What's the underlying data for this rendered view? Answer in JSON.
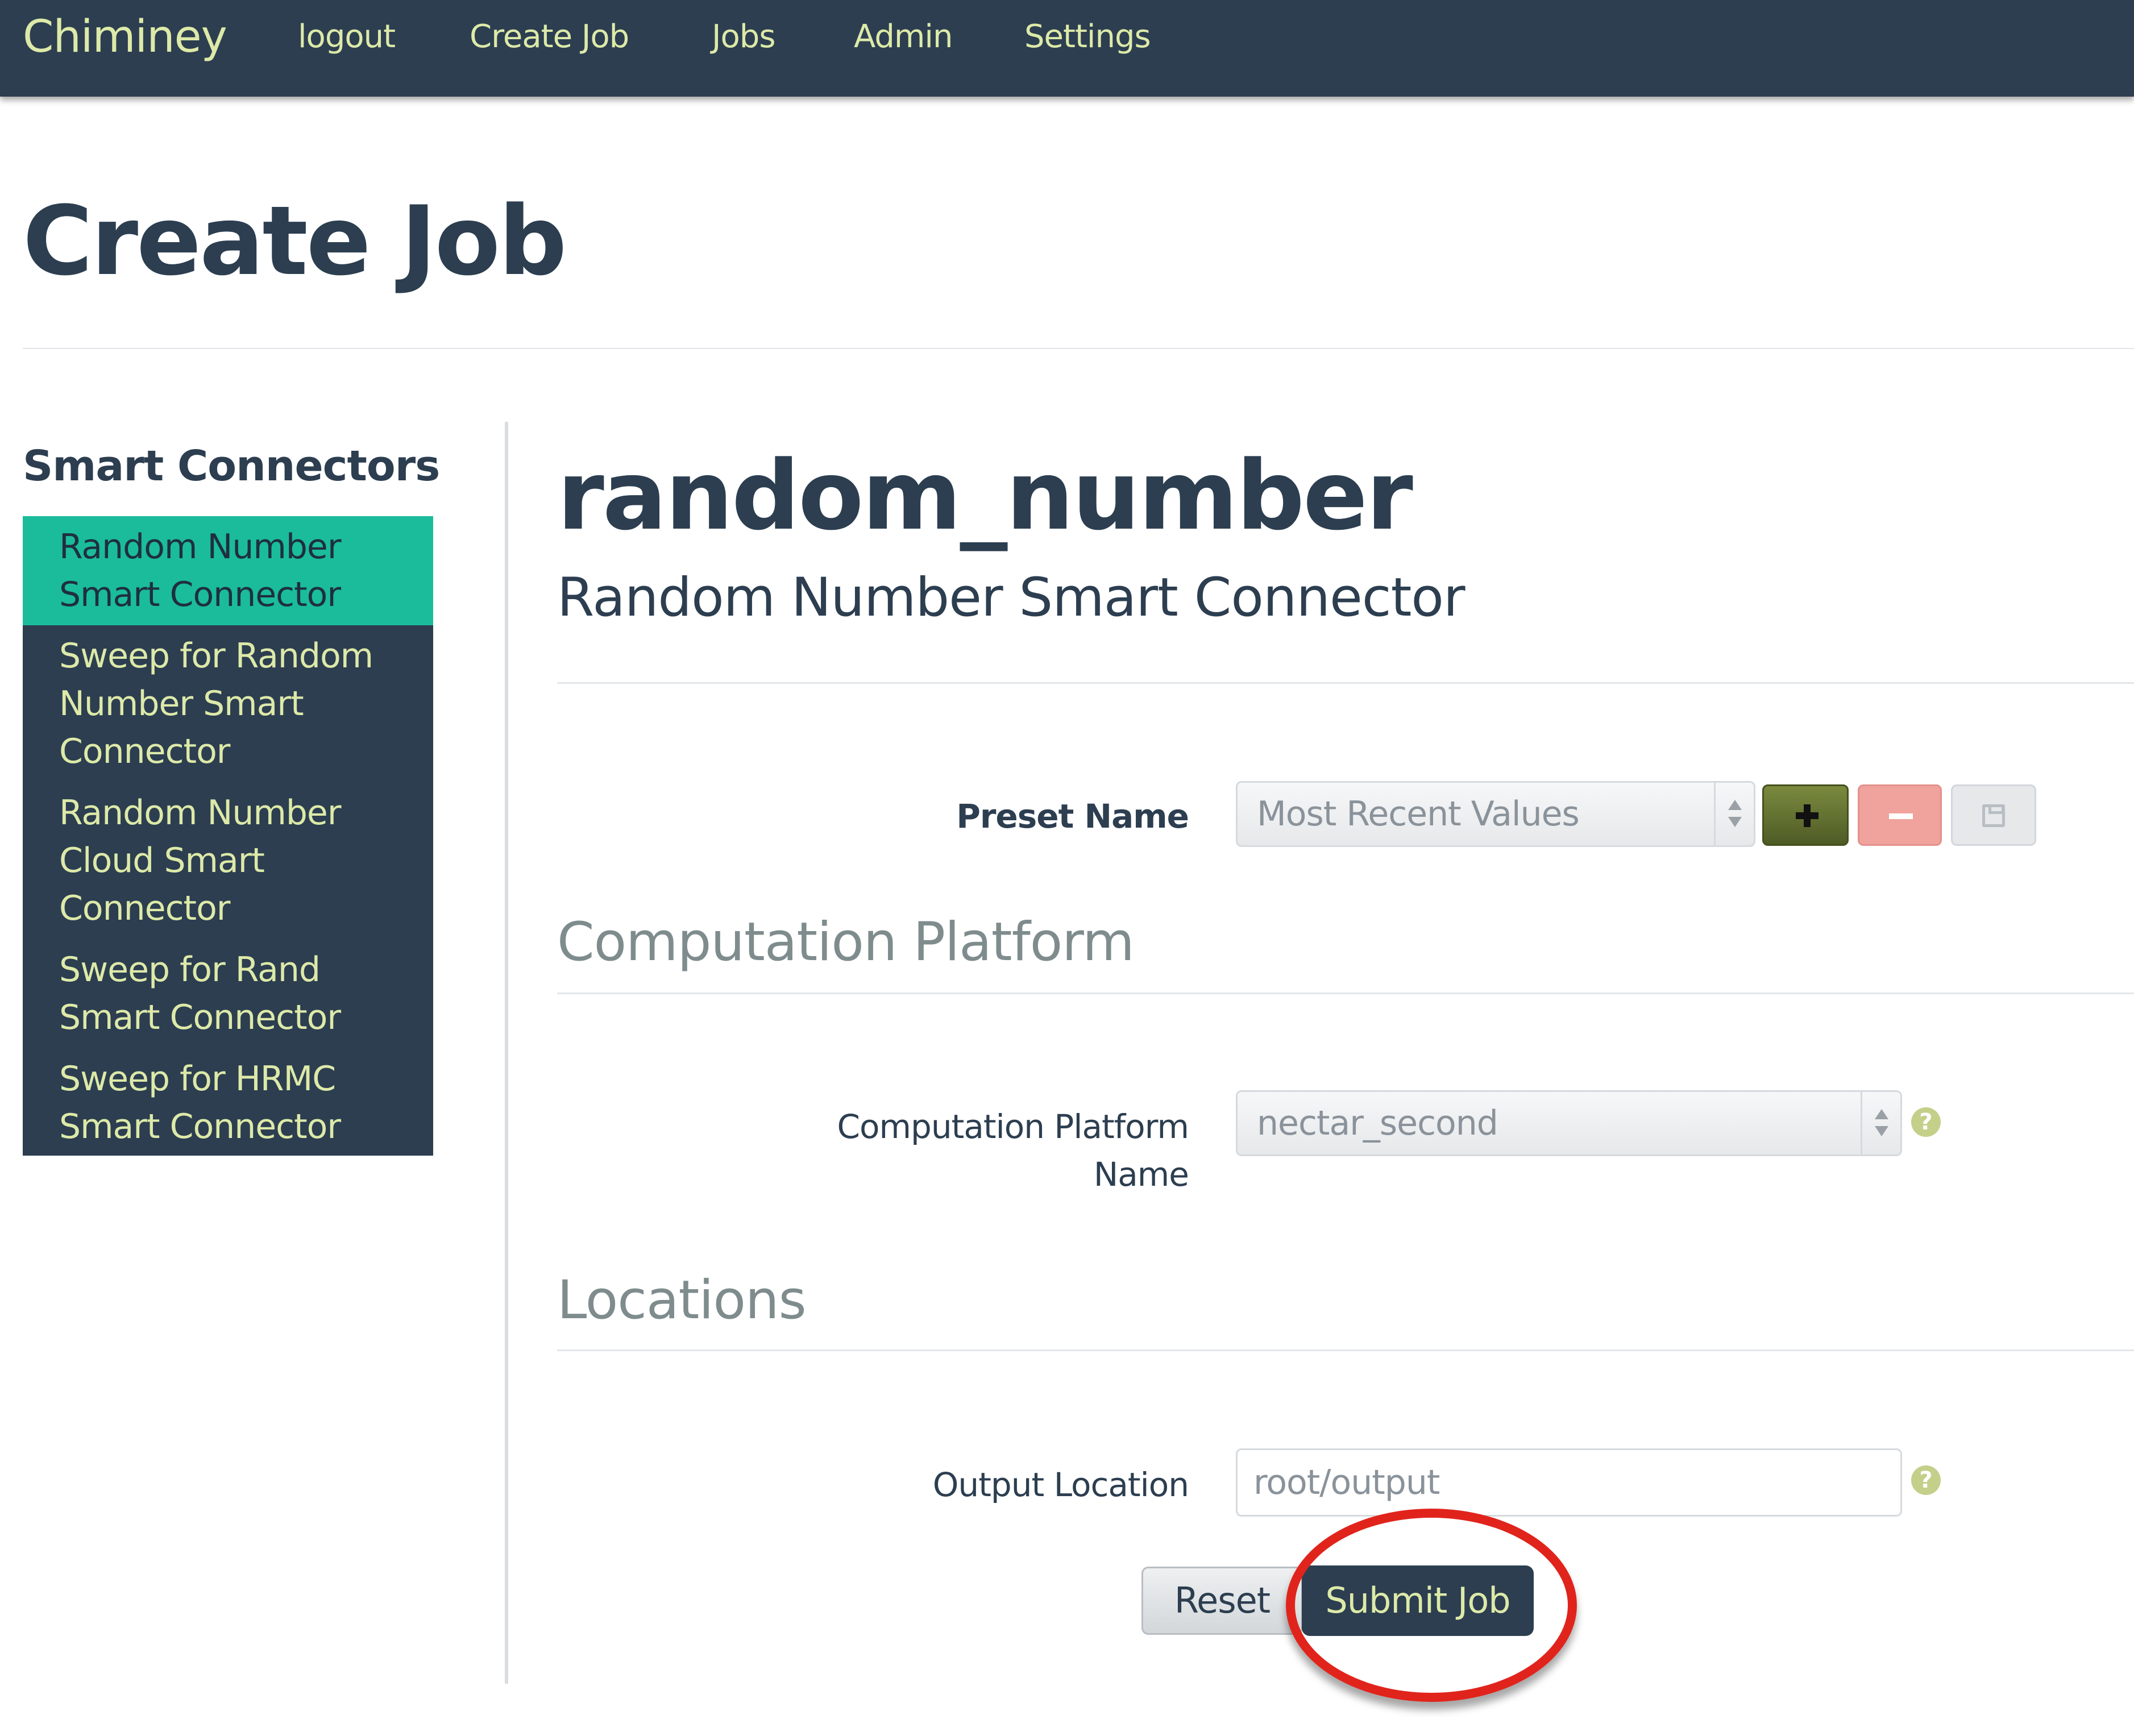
{
  "navbar": {
    "brand": "Chiminey",
    "links": [
      "logout",
      "Create Job",
      "Jobs",
      "Admin",
      "Settings"
    ]
  },
  "page": {
    "title": "Create Job"
  },
  "sidebar": {
    "heading": "Smart Connectors",
    "items": [
      {
        "label": "Random Number Smart Connector",
        "active": true
      },
      {
        "label": "Sweep for Random Number Smart Connector",
        "active": false
      },
      {
        "label": "Random Number Cloud Smart Connector",
        "active": false
      },
      {
        "label": "Sweep for Rand Smart Connector",
        "active": false
      },
      {
        "label": "Sweep for HRMC Smart Connector",
        "active": false
      }
    ]
  },
  "connector": {
    "title": "random_number",
    "subtitle": "Random Number Smart Connector"
  },
  "form": {
    "preset": {
      "label": "Preset Name",
      "value": "Most Recent Values",
      "add_icon": "plus-icon",
      "remove_icon": "minus-icon",
      "save_icon": "floppy-disk-icon"
    },
    "sections": {
      "computation": "Computation Platform",
      "locations": "Locations"
    },
    "platform": {
      "label": "Computation Platform Name",
      "value": "nectar_second",
      "help": "?"
    },
    "output": {
      "label": "Output Location",
      "value": "root/output",
      "help": "?"
    },
    "buttons": {
      "reset": "Reset",
      "submit": "Submit Job"
    }
  },
  "colors": {
    "navbar": "#2c3e50",
    "nav_text": "#dde9a8",
    "active_item": "#1abc9c",
    "add_button": "#5c6b2c",
    "remove_button": "#f0a39d",
    "highlight": "#e0241c"
  }
}
